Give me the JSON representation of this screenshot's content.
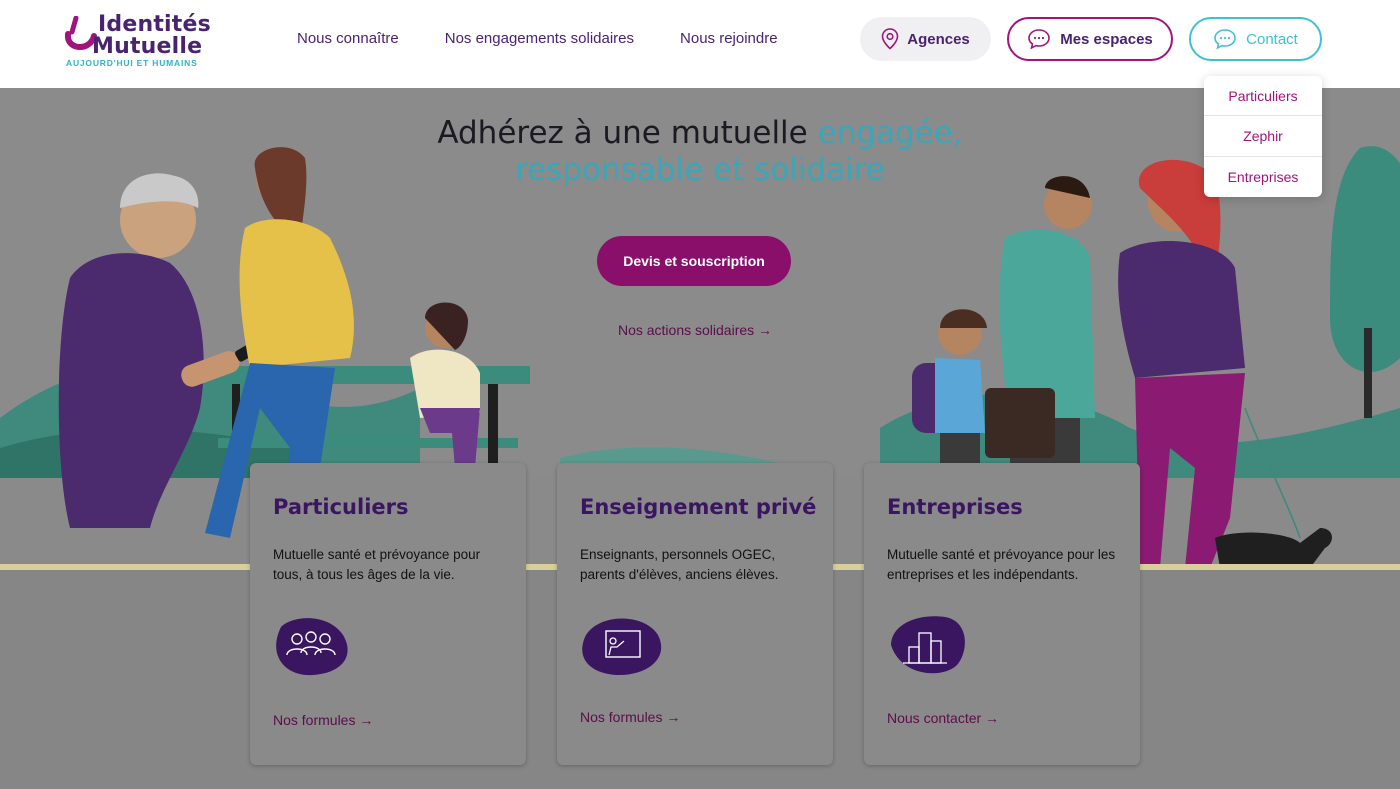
{
  "brand": {
    "line1": "Identités",
    "line2": "Mutuelle",
    "tagline": "AUJOURD'HUI ET HUMAINS"
  },
  "nav": {
    "items": [
      {
        "label": "Nous connaître"
      },
      {
        "label": "Nos engagements solidaires"
      },
      {
        "label": "Nous rejoindre"
      }
    ]
  },
  "header_buttons": {
    "agences": "Agences",
    "espaces": "Mes espaces",
    "contact": "Contact"
  },
  "contact_menu": {
    "items": [
      {
        "label": "Particuliers"
      },
      {
        "label": "Zephir"
      },
      {
        "label": "Entreprises"
      }
    ]
  },
  "hero": {
    "title_plain": "Adhérez à une mutuelle ",
    "title_accent_1": "engagée,",
    "title_accent_2": "responsable et solidaire",
    "cta": "Devis et souscription",
    "link": "Nos actions solidaires →"
  },
  "cards": [
    {
      "title": "Particuliers",
      "description": "Mutuelle santé et prévoyance pour tous, à tous les âges de la vie.",
      "link": "Nos formules →",
      "icon": "people-group-icon"
    },
    {
      "title": "Enseignement privé",
      "description": "Enseignants, personnels OGEC, parents d'élèves, anciens élèves.",
      "link": "Nos formules →",
      "icon": "teacher-board-icon"
    },
    {
      "title": "Entreprises",
      "description": "Mutuelle santé et prévoyance pour les entreprises et les indépendants.",
      "link": "Nous contacter →",
      "icon": "buildings-icon"
    }
  ],
  "colors": {
    "brand_purple": "#4a2370",
    "brand_magenta": "#a0147e",
    "brand_teal": "#3ec1d3",
    "cta_bg": "#8a0f6a"
  }
}
